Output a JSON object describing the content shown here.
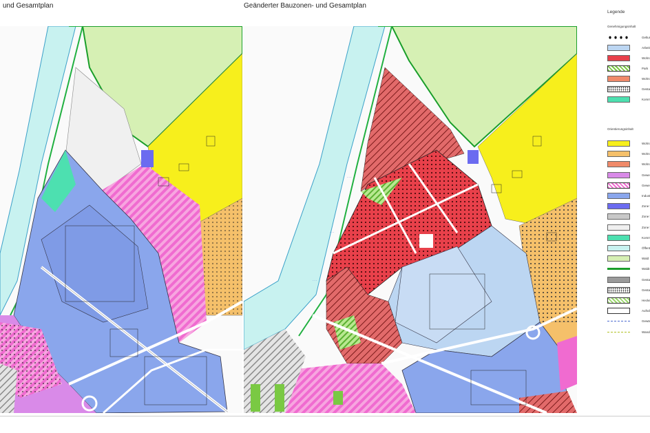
{
  "titles": {
    "left": "und Gesamtplan",
    "right": "Geänderter Bauzonen- und Gesamtplan"
  },
  "legend": {
    "title": "Legende",
    "section1": "Genehmigungsinhalt",
    "section2": "Orientierungsinhalt",
    "items1": [
      {
        "label": "Geltung",
        "style": "dots-heavy",
        "color": "#000000"
      },
      {
        "label": "Arbeits",
        "style": "fill",
        "color": "#bcd6f2"
      },
      {
        "label": "Wohnz",
        "style": "fill",
        "color": "#e8404a"
      },
      {
        "label": "Park",
        "style": "hatch",
        "color": "#7ac943"
      },
      {
        "label": "Wohnzo",
        "style": "fill",
        "color": "#f08a6a"
      },
      {
        "label": "Gestalt",
        "style": "dots",
        "color": "#ffffff"
      },
      {
        "label": "Kommu",
        "style": "fill",
        "color": "#4de0b0"
      }
    ],
    "items2": [
      {
        "label": "Wohnz",
        "style": "fill",
        "color": "#f7ef1c"
      },
      {
        "label": "Wohnz",
        "style": "fill",
        "color": "#f5c06a"
      },
      {
        "label": "Wohnz",
        "style": "fill",
        "color": "#f08a6a"
      },
      {
        "label": "Gewerb",
        "style": "fill",
        "color": "#d98ae8"
      },
      {
        "label": "Gewerb",
        "style": "hatch",
        "color": "#f06bd0"
      },
      {
        "label": "Industri",
        "style": "fill",
        "color": "#8aa6ec"
      },
      {
        "label": "Zone fü",
        "style": "fill",
        "color": "#6b6bf0"
      },
      {
        "label": "Zone fü",
        "style": "fill",
        "color": "#c8c8c8"
      },
      {
        "label": "Zone fü",
        "style": "fill",
        "color": "#f0f0f0"
      },
      {
        "label": "Kommu",
        "style": "fill",
        "color": "#4de0b0"
      },
      {
        "label": "Öffentl",
        "style": "fill",
        "color": "#c8f2f0"
      },
      {
        "label": "Wald",
        "style": "fill",
        "color": "#d6f0b4"
      },
      {
        "label": "Waldra",
        "style": "line",
        "color": "#1a9e2a"
      },
      {
        "label": "Gestalt",
        "style": "fill",
        "color": "#9a9a9a"
      },
      {
        "label": "Gestalt",
        "style": "dots",
        "color": "#ffffff"
      },
      {
        "label": "Hecken",
        "style": "hatch",
        "color": "#9ad86a"
      },
      {
        "label": "Aufschu",
        "style": "hatch",
        "color": "#ffffff"
      },
      {
        "label": "Gewäss",
        "style": "dash",
        "color": "#4a6ad0"
      },
      {
        "label": "Wander",
        "style": "dash",
        "color": "#b0c020"
      }
    ]
  }
}
